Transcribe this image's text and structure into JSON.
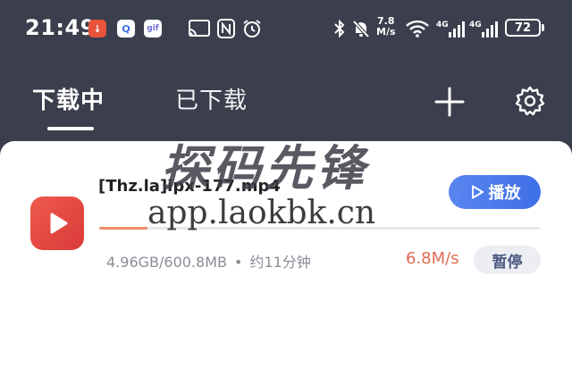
{
  "status_bar": {
    "time": "21:49",
    "badges": {
      "download": "↓",
      "q": "Q",
      "gif": "gif"
    },
    "net_speed_value": "7.8",
    "net_speed_unit": "M/s",
    "battery": "72"
  },
  "tabs": {
    "downloading": "下载中",
    "downloaded": "已下载"
  },
  "task": {
    "file_name": "[Thz.la]ipx-177.mp4",
    "size_info": "4.96GB/600.8MB",
    "separator": "•",
    "eta": "约11分钟",
    "speed": "6.8M/s",
    "play_label": "播放",
    "pause_label": "暂停"
  },
  "watermark": {
    "text_top": "探码先锋",
    "text_bottom": "app.laokbk.cn"
  },
  "colors": {
    "header_bg": "#3b3e4c",
    "accent_blue": "#4a78ea",
    "speed_red": "#e06b52",
    "icon_red": "#e04a40"
  }
}
